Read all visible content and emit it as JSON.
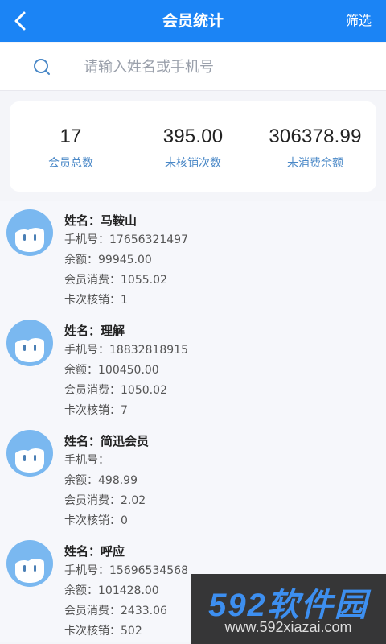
{
  "header": {
    "title": "会员统计",
    "filter_label": "筛选"
  },
  "search": {
    "placeholder": "请输入姓名或手机号"
  },
  "stats": [
    {
      "value": "17",
      "label": "会员总数"
    },
    {
      "value": "395.00",
      "label": "未核销次数"
    },
    {
      "value": "306378.99",
      "label": "未消费余额"
    }
  ],
  "members": [
    {
      "name_label": "姓名：",
      "name": "马鞍山",
      "phone_label": "手机号：",
      "phone": "17656321497",
      "balance_label": "余额：",
      "balance": "99945.00",
      "spend_label": "会员消费：",
      "spend": "1055.02",
      "redeem_label": "卡次核销：",
      "redeem": "1"
    },
    {
      "name_label": "姓名：",
      "name": "理解",
      "phone_label": "手机号：",
      "phone": "18832818915",
      "balance_label": "余额：",
      "balance": "100450.00",
      "spend_label": "会员消费：",
      "spend": "1050.02",
      "redeem_label": "卡次核销：",
      "redeem": "7"
    },
    {
      "name_label": "姓名：",
      "name": "简迅会员",
      "phone_label": "手机号：",
      "phone": "",
      "balance_label": "余额：",
      "balance": "498.99",
      "spend_label": "会员消费：",
      "spend": "2.02",
      "redeem_label": "卡次核销：",
      "redeem": "0"
    },
    {
      "name_label": "姓名：",
      "name": "呼应",
      "phone_label": "手机号：",
      "phone": "15696534568",
      "balance_label": "余额：",
      "balance": "101428.00",
      "spend_label": "会员消费：",
      "spend": "2433.06",
      "redeem_label": "卡次核销：",
      "redeem": "502"
    }
  ],
  "watermark": {
    "brand": "592软件园",
    "url": "www.592xiazai.com"
  },
  "colors": {
    "header_bg": "#1b84f5",
    "stat_label": "#4a88c7",
    "avatar_bg": "#7ab8f0"
  },
  "icons": {
    "back": "chevron-left-icon",
    "search": "search-icon",
    "avatar": "default-avatar-icon"
  }
}
